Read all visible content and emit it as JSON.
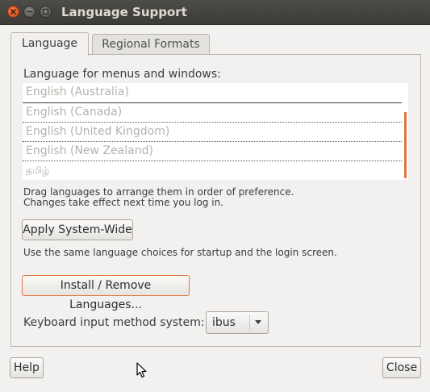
{
  "window": {
    "title": "Language Support",
    "controls": [
      "close-icon",
      "minimize-icon",
      "maximize-icon"
    ]
  },
  "tabs": [
    {
      "label": "Language",
      "active": true
    },
    {
      "label": "Regional Formats",
      "active": false
    }
  ],
  "language_section": {
    "heading": "Language for menus and windows:",
    "languages": [
      "English (Australia)",
      "English (Canada)",
      "English (United Kingdom)",
      "English (New Zealand)",
      "தமிழ்"
    ],
    "hint_line1": "Drag languages to arrange them in order of preference.",
    "hint_line2": "Changes take effect next time you log in."
  },
  "apply_button": {
    "label": "Apply System-Wide",
    "description": "Use the same language choices for startup and the login screen."
  },
  "install_button": {
    "label": "Install / Remove Languages..."
  },
  "keyboard": {
    "label": "Keyboard input method system:",
    "selected": "ibus"
  },
  "footer": {
    "help_label": "Help",
    "close_label": "Close"
  },
  "colors": {
    "accent": "#e0773e",
    "titlebar": "#3c3b37",
    "background": "#f2f1f0"
  }
}
